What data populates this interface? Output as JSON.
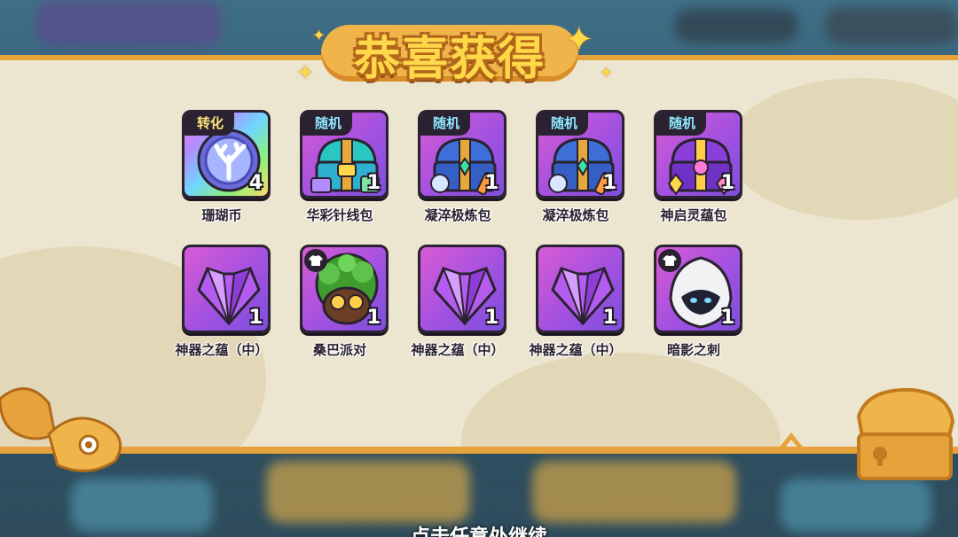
{
  "popup": {
    "title": "恭喜获得",
    "continue_hint": "点击任意处继续"
  },
  "rewards": [
    {
      "tag": "转化",
      "name": "珊瑚币",
      "qty": "4",
      "icon": "coral-coin-icon",
      "tag_type": "convert"
    },
    {
      "tag": "随机",
      "name": "华彩针线包",
      "qty": "1",
      "icon": "sewing-chest-icon",
      "tag_type": "random"
    },
    {
      "tag": "随机",
      "name": "凝淬极炼包",
      "qty": "1",
      "icon": "refining-chest-icon",
      "tag_type": "random"
    },
    {
      "tag": "随机",
      "name": "凝淬极炼包",
      "qty": "1",
      "icon": "refining-chest-icon",
      "tag_type": "random"
    },
    {
      "tag": "随机",
      "name": "神启灵蕴包",
      "qty": "1",
      "icon": "divine-chest-icon",
      "tag_type": "random"
    },
    {
      "name": "神器之蕴（中）",
      "qty": "1",
      "icon": "purple-crystal-icon"
    },
    {
      "name": "桑巴派对",
      "qty": "1",
      "icon": "samba-costume-icon",
      "badge": "shirt-icon"
    },
    {
      "name": "神器之蕴（中）",
      "qty": "1",
      "icon": "purple-crystal-icon"
    },
    {
      "name": "神器之蕴（中）",
      "qty": "1",
      "icon": "purple-crystal-icon"
    },
    {
      "name": "暗影之刺",
      "qty": "1",
      "icon": "shadow-hood-icon",
      "badge": "shirt-icon"
    }
  ],
  "colors": {
    "panel": "#ece5cf",
    "trim": "#e7a33b",
    "title_fill": "#ffd84a",
    "tile_purple": "#a251e0",
    "tag_convert": "#ffe27a",
    "tag_random": "#8fe7ff"
  }
}
